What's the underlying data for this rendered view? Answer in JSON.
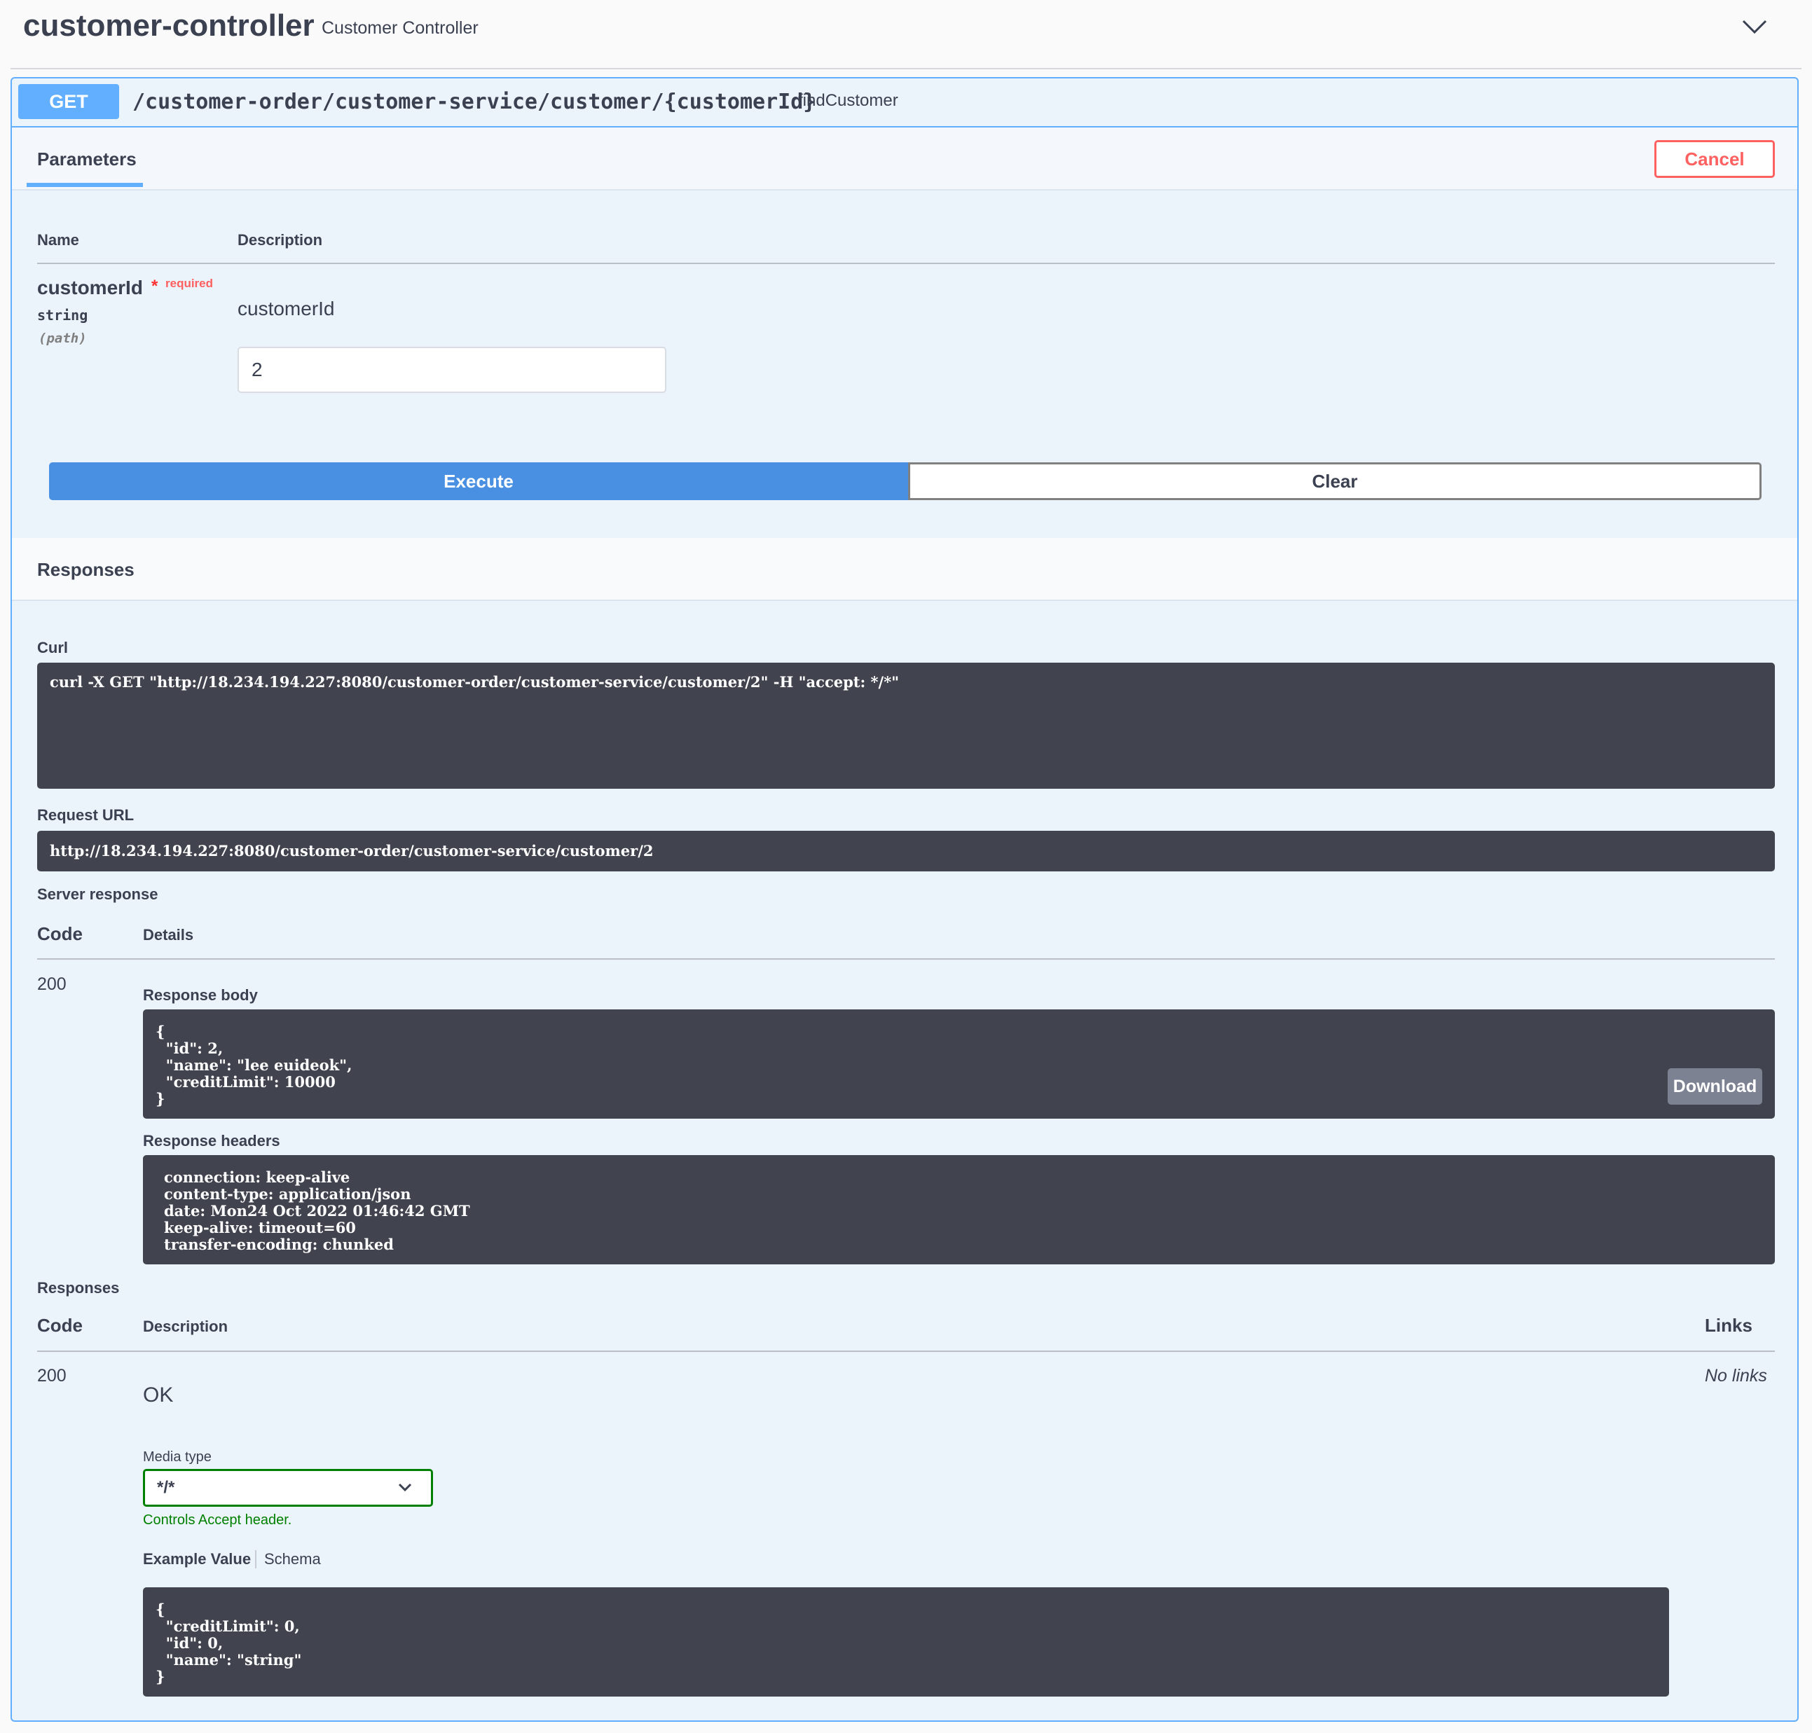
{
  "tag": {
    "title": "customer-controller",
    "description": "Customer Controller",
    "collapse_icon": "chevron-down-icon"
  },
  "operation": {
    "method": "GET",
    "path": "/customer-order/customer-service/customer/{customerId}",
    "operation_id": "findCustomer",
    "color": "#61affe"
  },
  "parameters": {
    "tab_label": "Parameters",
    "cancel_label": "Cancel",
    "header_name": "Name",
    "header_description": "Description",
    "items": [
      {
        "name": "customerId",
        "required_mark": "*",
        "required_label": "required",
        "type": "string",
        "location": "(path)",
        "description": "customerId",
        "value": "2"
      }
    ]
  },
  "actions": {
    "execute_label": "Execute",
    "clear_label": "Clear"
  },
  "responses_section": {
    "title": "Responses",
    "curl_label": "Curl",
    "curl_command": "curl -X GET \"http://18.234.194.227:8080/customer-order/customer-service/customer/2\" -H \"accept: */*\"",
    "request_url_label": "Request URL",
    "request_url": "http://18.234.194.227:8080/customer-order/customer-service/customer/2",
    "server_response_label": "Server response",
    "code_header": "Code",
    "details_header": "Details",
    "server_code": "200",
    "response_body_label": "Response body",
    "response_body": "{\n  \"id\": 2,\n  \"name\": \"lee euideok\",\n  \"creditLimit\": 10000\n}",
    "download_label": "Download",
    "response_headers_label": "Response headers",
    "response_headers": "connection: keep-alive\ncontent-type: application/json\ndate: Mon24 Oct 2022 01:46:42 GMT\nkeep-alive: timeout=60\ntransfer-encoding: chunked"
  },
  "documented_responses": {
    "label": "Responses",
    "code_header": "Code",
    "description_header": "Description",
    "links_header": "Links",
    "rows": [
      {
        "code": "200",
        "description": "OK",
        "links": "No links",
        "media_type_label": "Media type",
        "media_type_value": "*/*",
        "controls_note": "Controls Accept header.",
        "example_tab": "Example Value",
        "schema_tab": "Schema",
        "example_value": "{\n  \"creditLimit\": 0,\n  \"id\": 0,\n  \"name\": \"string\"\n}"
      }
    ]
  }
}
